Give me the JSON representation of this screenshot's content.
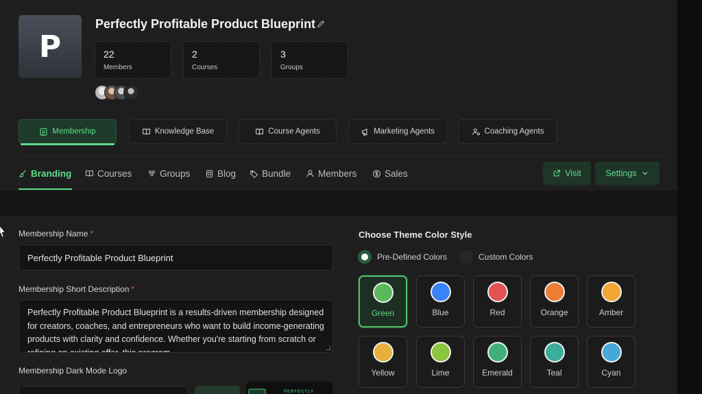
{
  "header": {
    "logo_letter": "P",
    "title": "Perfectly Profitable Product Blueprint",
    "stats": [
      {
        "value": "22",
        "label": "Members"
      },
      {
        "value": "2",
        "label": "Courses"
      },
      {
        "value": "3",
        "label": "Groups"
      }
    ]
  },
  "pills": [
    {
      "label": "Membership",
      "icon": "id-card-icon"
    },
    {
      "label": "Knowledge Base",
      "icon": "book-open-icon"
    },
    {
      "label": "Course Agents",
      "icon": "book-open-icon"
    },
    {
      "label": "Marketing Agents",
      "icon": "megaphone-icon"
    },
    {
      "label": "Coaching Agents",
      "icon": "user-gear-icon"
    }
  ],
  "tabs": [
    {
      "label": "Branding",
      "icon": "paintbrush-icon"
    },
    {
      "label": "Courses",
      "icon": "book-open-icon"
    },
    {
      "label": "Groups",
      "icon": "users-icon"
    },
    {
      "label": "Blog",
      "icon": "document-icon"
    },
    {
      "label": "Bundle",
      "icon": "tag-icon"
    },
    {
      "label": "Members",
      "icon": "user-icon"
    },
    {
      "label": "Sales",
      "icon": "dollar-circle-icon"
    }
  ],
  "actions": {
    "visit_label": "Visit",
    "settings_label": "Settings"
  },
  "form": {
    "name_label": "Membership Name",
    "name_value": "Perfectly Profitable Product Blueprint",
    "desc_label": "Membership Short Description",
    "desc_value": "Perfectly Profitable Product Blueprint is a results-driven membership designed for creators, coaches, and entrepreneurs who want to build income-generating products with clarity and confidence. Whether you're starting from scratch or refining an existing offer, this program",
    "logo_label": "Membership Dark Mode Logo",
    "logo_preview_text": "PERFECTLY",
    "required_mark": "*"
  },
  "theme": {
    "title": "Choose Theme Color Style",
    "options": [
      "Pre-Defined Colors",
      "Custom Colors"
    ],
    "selected_option": "Pre-Defined Colors",
    "selected_color": "Green",
    "colors": [
      {
        "name": "Green",
        "hex": "#5cb85c"
      },
      {
        "name": "Blue",
        "hex": "#3b82f6"
      },
      {
        "name": "Red",
        "hex": "#e25252"
      },
      {
        "name": "Orange",
        "hex": "#ee7d33"
      },
      {
        "name": "Amber",
        "hex": "#f0a733"
      },
      {
        "name": "Yellow",
        "hex": "#e6b03a"
      },
      {
        "name": "Lime",
        "hex": "#8cc63f"
      },
      {
        "name": "Emerald",
        "hex": "#3fb07a"
      },
      {
        "name": "Teal",
        "hex": "#3aae9a"
      },
      {
        "name": "Cyan",
        "hex": "#45a8d6"
      }
    ]
  },
  "colors": {
    "accent": "#5ddc8a",
    "required": "#e05a5a"
  }
}
